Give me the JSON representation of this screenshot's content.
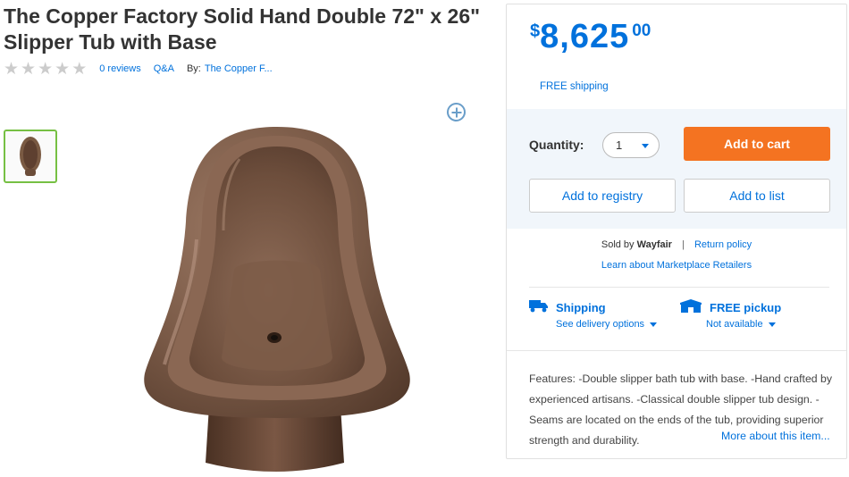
{
  "product": {
    "title": "The Copper Factory Solid Hand Double 72\" x 26\" Slipper Tub with Base",
    "rating_stars": 0,
    "reviews_label": "0 reviews",
    "qa_label": "Q&A",
    "by_label": "By:",
    "brand_label": "The Copper F...",
    "icons": {
      "zoom": "zoom-in-icon",
      "stars": "star-icon"
    }
  },
  "gallery": {
    "thumbnails": [
      {
        "selected": true,
        "subject": "copper slipper tub"
      }
    ],
    "selected_thumb_border_color": "#76c043"
  },
  "buybox": {
    "price": {
      "currency": "$",
      "whole": "8,625",
      "cents": "00",
      "color": "#0071dc"
    },
    "free_shipping": "FREE shipping",
    "quantity_label": "Quantity:",
    "quantity_value": "1",
    "add_to_cart": "Add to cart",
    "add_to_cart_color": "#f47321",
    "add_to_registry": "Add to registry",
    "add_to_list": "Add to list",
    "sold_by_prefix": "Sold by",
    "sold_by_name": "Wayfair",
    "separator": "|",
    "return_policy": "Return policy",
    "marketplace_link": "Learn about Marketplace Retailers",
    "shipping": {
      "title": "Shipping",
      "sub": "See delivery options",
      "icon": "truck-icon"
    },
    "pickup": {
      "title": "FREE pickup",
      "sub": "Not available",
      "icon": "store-icon"
    },
    "features": "Features: -Double slipper bath tub with base. -Hand crafted by experienced artisans. -Classical double slipper tub design. -Seams are located on the ends of the tub, providing superior strength and durability.",
    "more_link": "More about this item..."
  }
}
